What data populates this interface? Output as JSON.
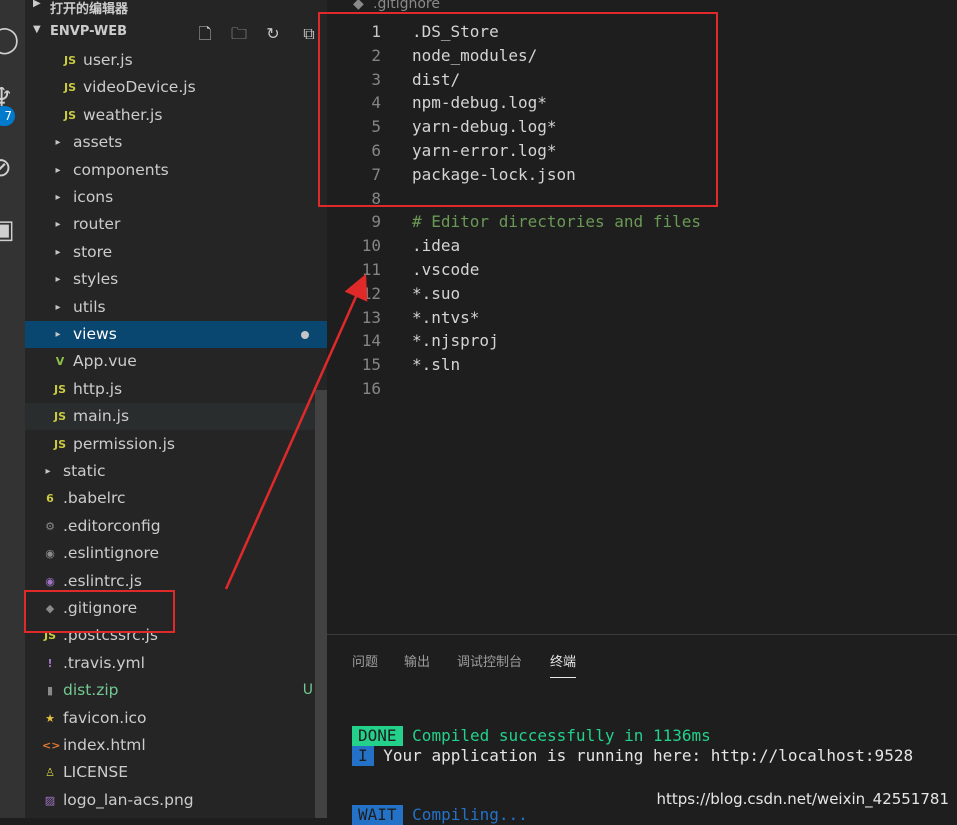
{
  "activity": {
    "badge": "7"
  },
  "sidebar": {
    "open_editors_label": "打开的编辑器",
    "project_label": "ENVP-WEB",
    "items": [
      {
        "label": "user.js",
        "icon": "JS"
      },
      {
        "label": "videoDevice.js",
        "icon": "JS"
      },
      {
        "label": "weather.js",
        "icon": "JS"
      },
      {
        "label": "assets",
        "icon": "▸"
      },
      {
        "label": "components",
        "icon": "▸"
      },
      {
        "label": "icons",
        "icon": "▸"
      },
      {
        "label": "router",
        "icon": "▸"
      },
      {
        "label": "store",
        "icon": "▸"
      },
      {
        "label": "styles",
        "icon": "▸"
      },
      {
        "label": "utils",
        "icon": "▸"
      },
      {
        "label": "views",
        "icon": "▸"
      },
      {
        "label": "App.vue",
        "icon": "V"
      },
      {
        "label": "http.js",
        "icon": "JS"
      },
      {
        "label": "main.js",
        "icon": "JS"
      },
      {
        "label": "permission.js",
        "icon": "JS"
      },
      {
        "label": "static",
        "icon": "▸"
      },
      {
        "label": ".babelrc",
        "icon": "6"
      },
      {
        "label": ".editorconfig",
        "icon": "⚙"
      },
      {
        "label": ".eslintignore",
        "icon": "◉"
      },
      {
        "label": ".eslintrc.js",
        "icon": "◉"
      },
      {
        "label": ".gitignore",
        "icon": "◆"
      },
      {
        "label": ".postcssrc.js",
        "icon": "JS"
      },
      {
        "label": ".travis.yml",
        "icon": "!"
      },
      {
        "label": "dist.zip",
        "icon": "▮",
        "badge": "U"
      },
      {
        "label": "favicon.ico",
        "icon": "★"
      },
      {
        "label": "index.html",
        "icon": "<>"
      },
      {
        "label": "LICENSE",
        "icon": "♙"
      },
      {
        "label": "logo_lan-acs.png",
        "icon": "▨"
      }
    ]
  },
  "editor": {
    "tab_label": ".gitignore",
    "lines": [
      {
        "n": "1",
        "text": ".DS_Store"
      },
      {
        "n": "2",
        "text": "node_modules/"
      },
      {
        "n": "3",
        "text": "dist/"
      },
      {
        "n": "4",
        "text": "npm-debug.log*"
      },
      {
        "n": "5",
        "text": "yarn-debug.log*"
      },
      {
        "n": "6",
        "text": "yarn-error.log*"
      },
      {
        "n": "7",
        "text": "package-lock.json"
      },
      {
        "n": "8",
        "text": ""
      },
      {
        "n": "9",
        "text": "# Editor directories and files"
      },
      {
        "n": "10",
        "text": ".idea"
      },
      {
        "n": "11",
        "text": ".vscode"
      },
      {
        "n": "12",
        "text": "*.suo"
      },
      {
        "n": "13",
        "text": "*.ntvs*"
      },
      {
        "n": "14",
        "text": "*.njsproj"
      },
      {
        "n": "15",
        "text": "*.sln"
      },
      {
        "n": "16",
        "text": ""
      }
    ]
  },
  "panel": {
    "tabs": [
      "问题",
      "输出",
      "调试控制台",
      "终端"
    ],
    "terminal": {
      "done_tag": "DONE",
      "done_text": "Compiled successfully in 1136ms",
      "info_tag": "I",
      "info_text": "Your application is running here: http://localhost:9528",
      "wait_tag": "WAIT",
      "wait_text": "Compiling..."
    }
  },
  "watermark": "https://blog.csdn.net/weixin_42551781",
  "colors": {
    "accent": "#007acc",
    "selection": "#094771",
    "annotation_red": "#e02a2a",
    "done_green": "#23d18b",
    "info_blue": "#2472c8",
    "comment_green": "#6a9955"
  }
}
